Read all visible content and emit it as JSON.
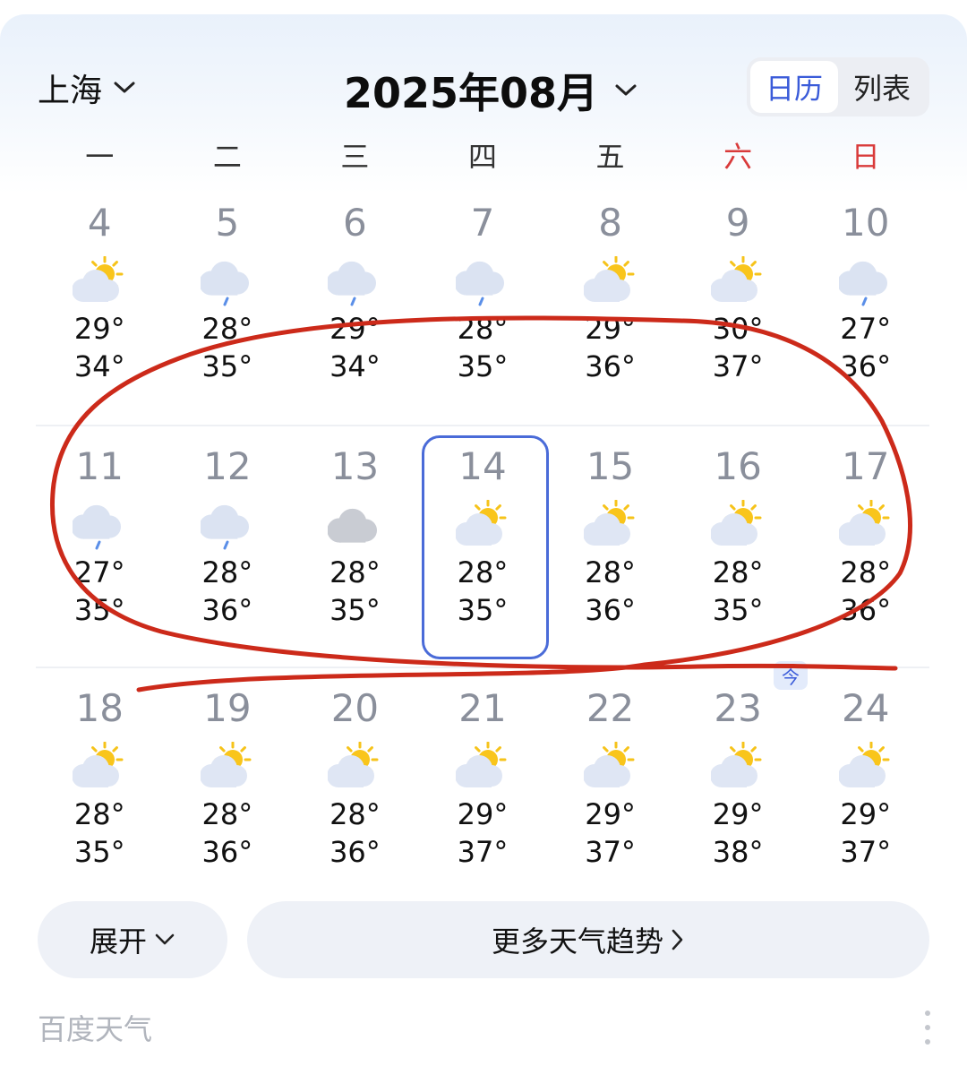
{
  "header": {
    "city": "上海",
    "month": "2025年08月",
    "view_toggle": {
      "calendar": "日历",
      "list": "列表",
      "active": "calendar"
    }
  },
  "weekdays": [
    "一",
    "二",
    "三",
    "四",
    "五",
    "六",
    "日"
  ],
  "weeks": [
    [
      {
        "day": "4",
        "weather": "partly-sunny",
        "low": "29°",
        "high": "34°"
      },
      {
        "day": "5",
        "weather": "light-rain",
        "low": "28°",
        "high": "35°"
      },
      {
        "day": "6",
        "weather": "light-rain",
        "low": "29°",
        "high": "34°"
      },
      {
        "day": "7",
        "weather": "light-rain",
        "low": "28°",
        "high": "35°"
      },
      {
        "day": "8",
        "weather": "partly-sunny",
        "low": "29°",
        "high": "36°"
      },
      {
        "day": "9",
        "weather": "partly-sunny",
        "low": "30°",
        "high": "37°"
      },
      {
        "day": "10",
        "weather": "light-rain",
        "low": "27°",
        "high": "36°"
      }
    ],
    [
      {
        "day": "11",
        "weather": "light-rain",
        "low": "27°",
        "high": "35°"
      },
      {
        "day": "12",
        "weather": "light-rain",
        "low": "28°",
        "high": "36°"
      },
      {
        "day": "13",
        "weather": "cloudy",
        "low": "28°",
        "high": "35°"
      },
      {
        "day": "14",
        "weather": "partly-sunny",
        "low": "28°",
        "high": "35°",
        "selected": true
      },
      {
        "day": "15",
        "weather": "partly-sunny",
        "low": "28°",
        "high": "36°"
      },
      {
        "day": "16",
        "weather": "partly-sunny",
        "low": "28°",
        "high": "35°"
      },
      {
        "day": "17",
        "weather": "partly-sunny",
        "low": "28°",
        "high": "36°"
      }
    ],
    [
      {
        "day": "18",
        "weather": "partly-sunny",
        "low": "28°",
        "high": "35°"
      },
      {
        "day": "19",
        "weather": "partly-sunny",
        "low": "28°",
        "high": "36°"
      },
      {
        "day": "20",
        "weather": "partly-sunny",
        "low": "28°",
        "high": "36°"
      },
      {
        "day": "21",
        "weather": "partly-sunny",
        "low": "29°",
        "high": "37°"
      },
      {
        "day": "22",
        "weather": "partly-sunny",
        "low": "29°",
        "high": "37°"
      },
      {
        "day": "23",
        "weather": "partly-sunny",
        "low": "29°",
        "high": "38°"
      },
      {
        "day": "24",
        "weather": "partly-sunny",
        "low": "29°",
        "high": "37°"
      }
    ]
  ],
  "today_tag": "今",
  "buttons": {
    "expand": "展开",
    "more_trend": "更多天气趋势"
  },
  "footer": {
    "source": "百度天气"
  },
  "colors": {
    "accent": "#3a5bd9",
    "weekend": "#d93a3a",
    "selected_border": "#4a6bd8",
    "annotation_ink": "#cc2a1a"
  }
}
